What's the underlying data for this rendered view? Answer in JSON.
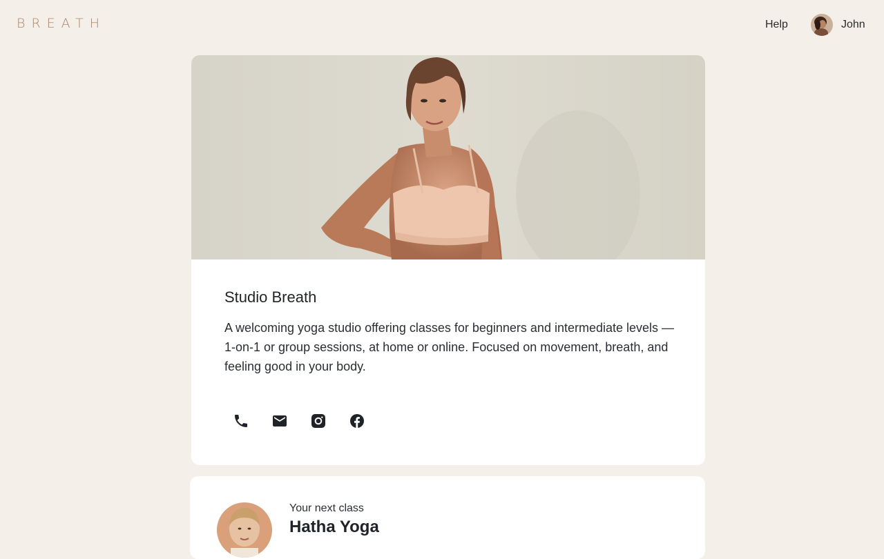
{
  "header": {
    "logo": "BREATH",
    "help_label": "Help",
    "user_name": "John"
  },
  "studio": {
    "title": "Studio Breath",
    "description": "A welcoming yoga studio offering classes for beginners and intermediate levels — 1-on-1 or group sessions, at home or online. Focused on movement, breath, and feeling good in your body.",
    "contact_icons": [
      "phone-icon",
      "email-icon",
      "instagram-icon",
      "facebook-icon"
    ]
  },
  "next_class": {
    "label": "Your next class",
    "name": "Hatha Yoga"
  },
  "colors": {
    "background": "#f4efe9",
    "card": "#ffffff",
    "logo": "#a9876b",
    "text": "#1f2328"
  }
}
